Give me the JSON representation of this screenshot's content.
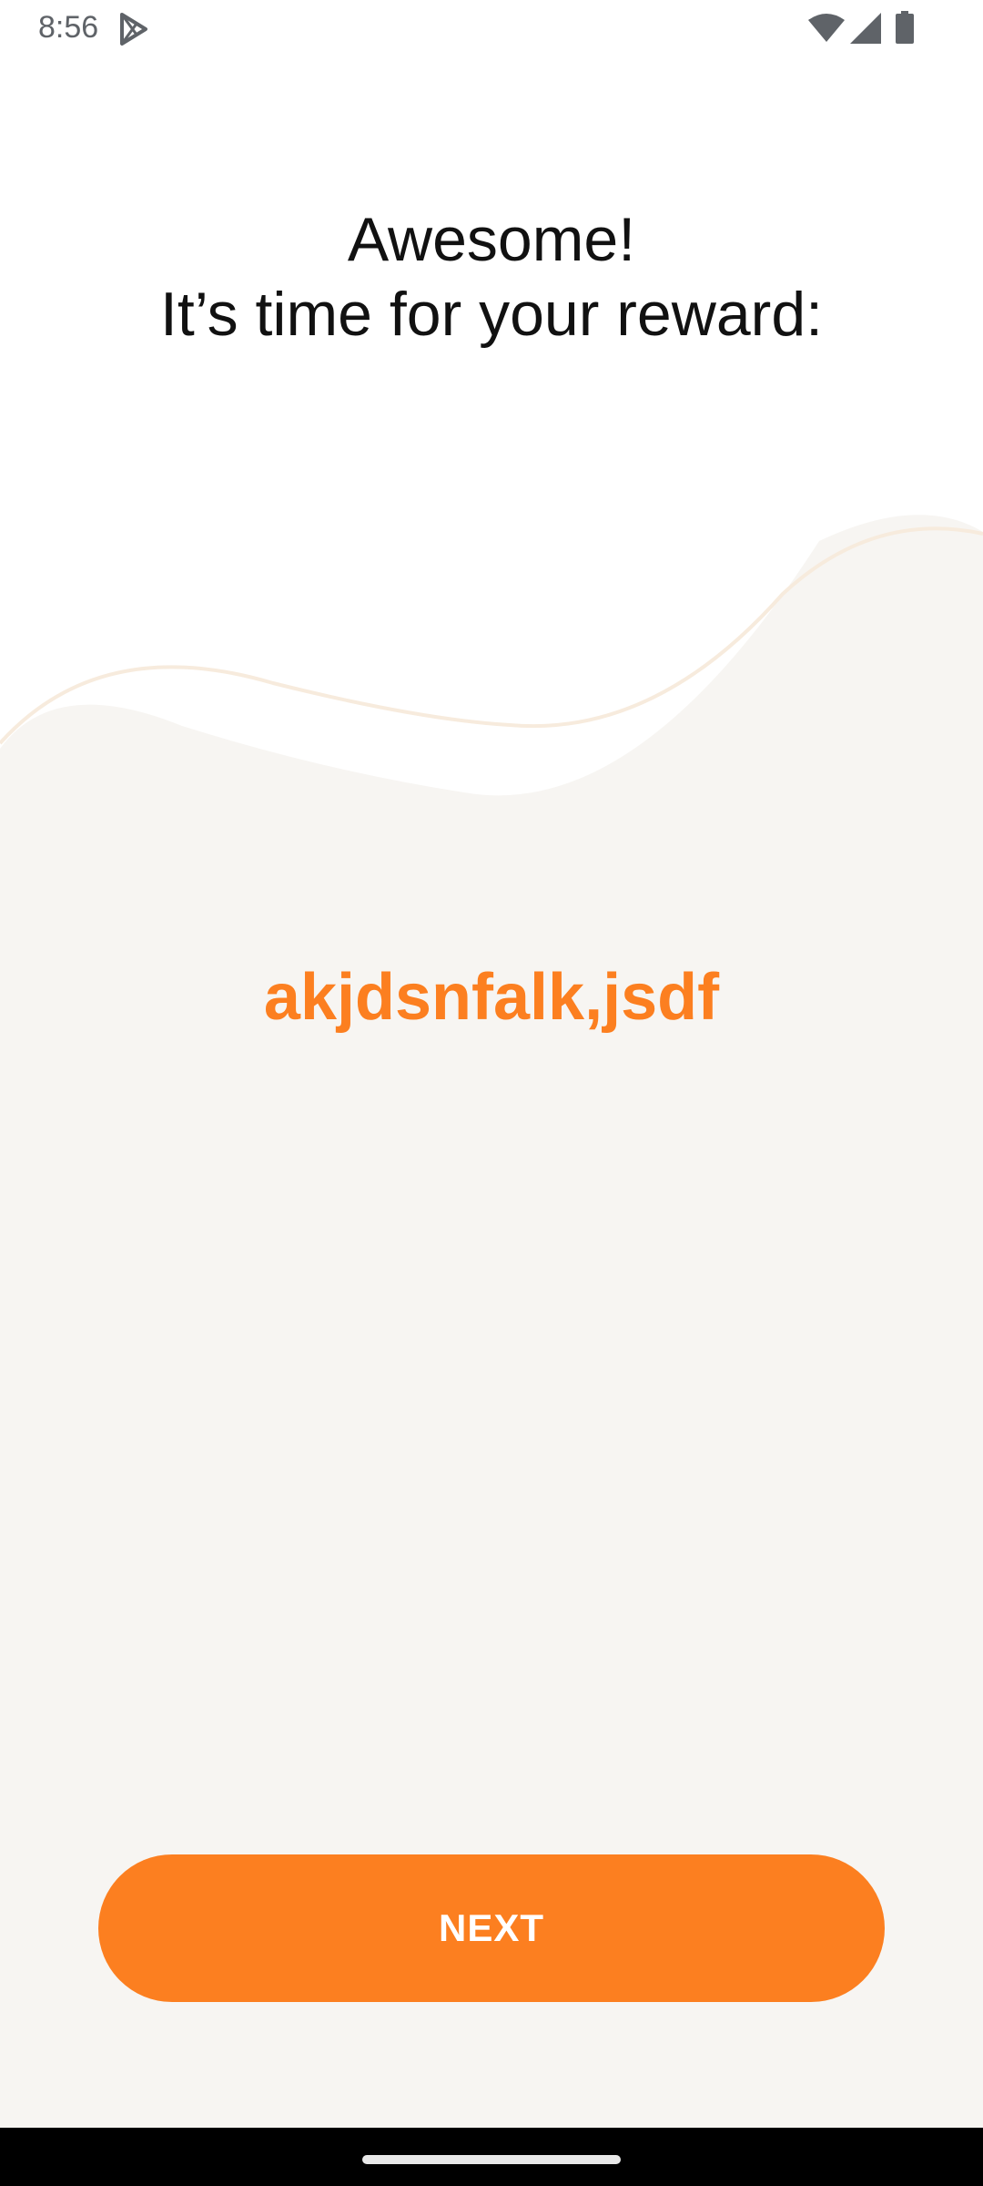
{
  "status_bar": {
    "time": "8:56",
    "icons": [
      "play-store-icon",
      "wifi-icon",
      "signal-icon",
      "battery-icon"
    ]
  },
  "heading": {
    "line1": "Awesome!",
    "line2": "It’s time for your reward:"
  },
  "reward": {
    "code": "akjdsnfalk,jsdf"
  },
  "actions": {
    "next_label": "NEXT"
  },
  "colors": {
    "accent": "#fc7f20",
    "wave_fill": "#f7f5f2",
    "wave_stroke": "#f7ebdd",
    "background": "#ffffff",
    "nav_bar": "#000000"
  }
}
